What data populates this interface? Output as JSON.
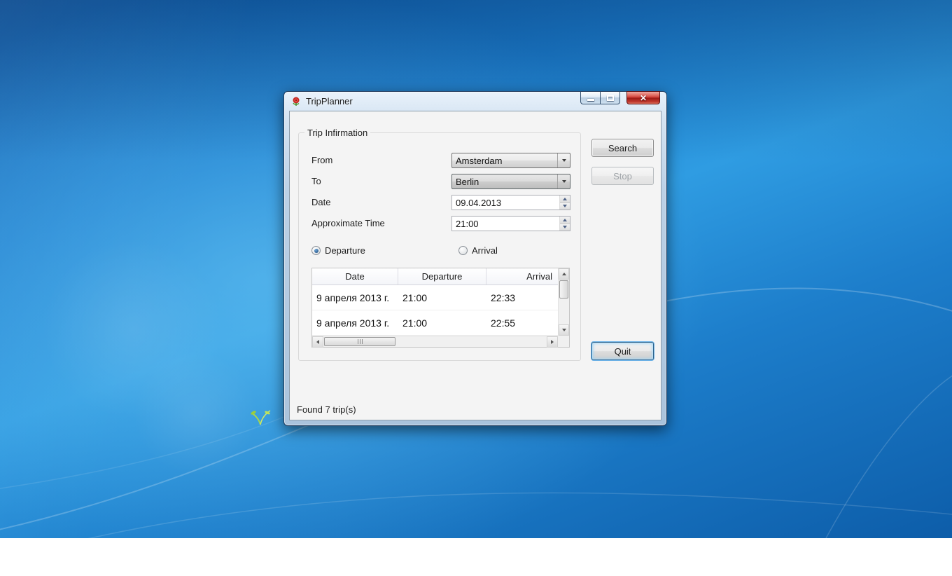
{
  "window": {
    "title": "TripPlanner"
  },
  "form": {
    "group_title": "Trip Infirmation",
    "fields": [
      {
        "label": "From",
        "value": "Amsterdam"
      },
      {
        "label": "To",
        "value": "Berlin"
      },
      {
        "label": "Date",
        "value": "09.04.2013"
      },
      {
        "label": "Approximate Time",
        "value": "21:00"
      }
    ],
    "radios": [
      {
        "label": "Departure",
        "checked": "true"
      },
      {
        "label": "Arrival",
        "checked": "false"
      }
    ]
  },
  "table": {
    "columns": [
      "Date",
      "Departure",
      "Arrival"
    ],
    "rows": [
      [
        "9 апреля 2013 г.",
        "21:00",
        "22:33"
      ],
      [
        "9 апреля 2013 г.",
        "21:00",
        "22:55"
      ]
    ]
  },
  "buttons": {
    "search": "Search",
    "stop": "Stop",
    "quit": "Quit"
  },
  "status": "Found 7 trip(s)"
}
